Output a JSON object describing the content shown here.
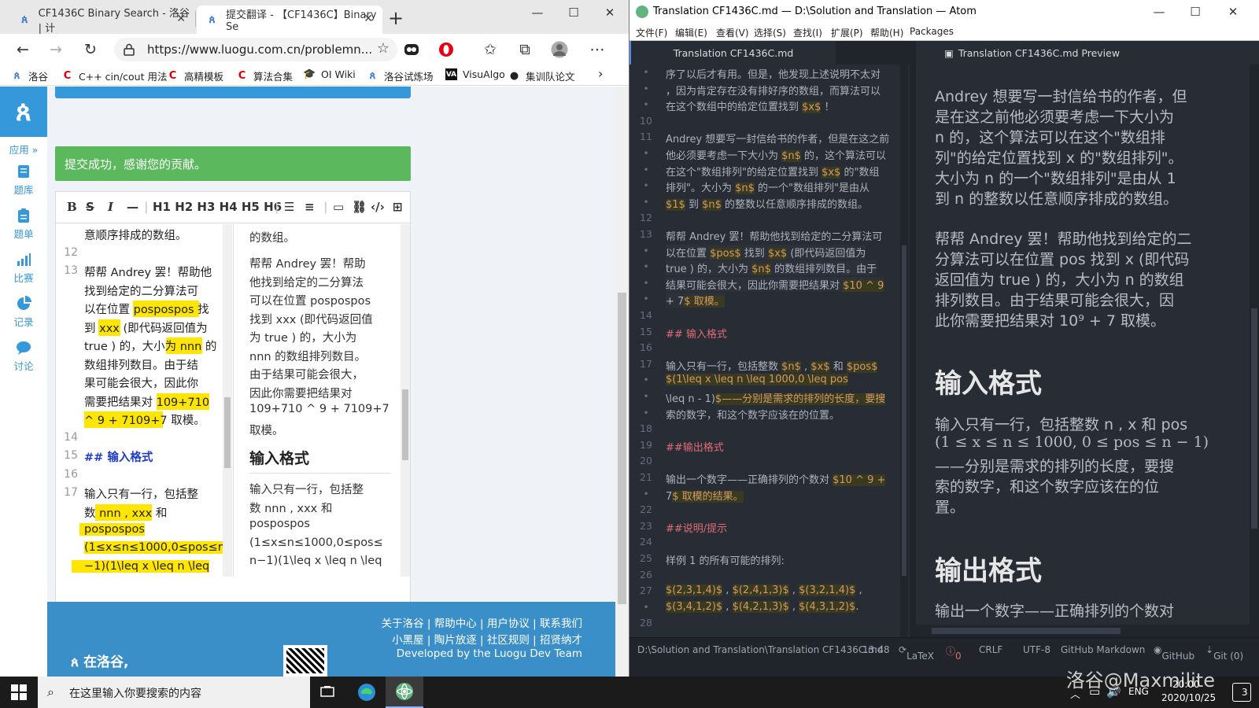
{
  "edge": {
    "tabs": [
      {
        "title": "CF1436C Binary Search - 洛谷 | 计"
      },
      {
        "title": "提交翻译 - 【CF1436C】Binary Se"
      }
    ],
    "url": "https://www.luogu.com.cn/problemn...",
    "bookmarks": [
      "洛谷",
      "C++ cin/cout 用法",
      "高精模板",
      "算法合集",
      "OI Wiki",
      "洛谷试炼场",
      "VisuAlgo",
      "集训队论文"
    ]
  },
  "luogu": {
    "sidebar": [
      {
        "label": "应用 »"
      },
      {
        "label": "题库"
      },
      {
        "label": "题单"
      },
      {
        "label": "比赛"
      },
      {
        "label": "记录"
      },
      {
        "label": "讨论"
      }
    ],
    "success": "提交成功，感谢您的贡献。",
    "toolbar_headings": "H1 H2 H3 H4 H5 H6",
    "source_lines": [
      {
        "n": "",
        "t": "意顺序排成的数组。"
      },
      {
        "n": "12",
        "t": ""
      },
      {
        "n": "13",
        "t": "帮帮 Andrey 罢！帮助他"
      },
      {
        "n": "",
        "t": "找到给定的二分算法可"
      },
      {
        "n": "",
        "t": "以在位置 pospospos 找"
      },
      {
        "n": "",
        "t": "到 xxx (即代码返回值为"
      },
      {
        "n": "",
        "t": "true ) 的，大小为 nnn 的"
      },
      {
        "n": "",
        "t": "数组排列数目。由于结"
      },
      {
        "n": "",
        "t": "果可能会很大，因此你"
      },
      {
        "n": "",
        "t": "需要把结果对 109+710"
      },
      {
        "n": "",
        "t": "^ 9 + 7109+7 取模。"
      },
      {
        "n": "14",
        "t": ""
      },
      {
        "n": "15",
        "t": "## 输入格式"
      },
      {
        "n": "16",
        "t": ""
      },
      {
        "n": "17",
        "t": "输入只有一行，包括整"
      },
      {
        "n": "",
        "t": "数 nnn , xxx 和"
      },
      {
        "n": "",
        "t": "pospospos"
      },
      {
        "n": "",
        "t": "(1≤x≤n≤1000,0≤pos≤n"
      },
      {
        "n": "",
        "t": "−1)(1\\leq x \\leq n \\leq"
      }
    ],
    "preview_lines": [
      "的数组。",
      "帮帮 Andrey 罢！帮助",
      "他找到给定的二分算法",
      "可以在位置 pospospos",
      "找到 xxx (即代码返回值",
      "为 true ) 的，大小为",
      "nnn 的数组排列数目。",
      "由于结果可能会很大，",
      "因此你需要把结果对",
      "109+710 ^ 9 + 7109+7",
      "取模。"
    ],
    "preview_heading": "输入格式",
    "preview_lines2": [
      "输入只有一行，包括整",
      "数 nnn , xxx 和",
      "pospospos",
      "(1≤x≤n≤1000,0≤pos≤",
      "n−1)(1\\leq x \\leq n \\leq"
    ],
    "footer": {
      "links1": "关于洛谷 | 帮助中心 | 用户协议 | 联系我们",
      "links2": "小黑屋 | 陶片放逐 | 社区规则 | 招贤纳才",
      "credit": "Developed by the Luogu Dev Team",
      "brand": "在洛谷,"
    }
  },
  "atom": {
    "title": "Translation CF1436C.md — D:\\Solution and Translation — Atom",
    "menu": [
      "文件(F)",
      "编辑(E)",
      "查看(V)",
      "选择(S)",
      "查找(I)",
      "扩展(P)",
      "帮助(H)",
      "Packages"
    ],
    "tab_editor": "Translation CF1436C.md",
    "tab_preview": "Translation CF1436C.md Preview",
    "gutter": [
      "•",
      "•",
      "•",
      "10",
      "11",
      "•",
      "•",
      "•",
      "•",
      "12",
      "13",
      "•",
      "•",
      "•",
      "•",
      "14",
      "15",
      "16",
      "17",
      "•",
      "•",
      "•",
      "18",
      "19",
      "20",
      "21",
      "•",
      "22",
      "23",
      "24",
      "25",
      "26",
      "27",
      "•",
      "28"
    ],
    "code_lines": [
      "序了以后才有用。但是，他发现上述说明不太对",
      "，因为肯定存在没有排好序的数组，而算法可以",
      "在这个数组中的给定位置找到 $x$ ！",
      "",
      "Andrey 想要写一封信给书的作者，但是在这之前",
      "他必须要考虑一下大小为 $n$ 的，这个算法可以",
      "在这个\"数组排列\"的给定位置找到 $x$ 的\"数组",
      "排列\"。大小为 $n$ 的一个\"数组排列\"是由从",
      "$1$ 到 $n$ 的整数以任意顺序排成的数组。",
      "",
      "帮帮 Andrey 罢！帮助他找到给定的二分算法可",
      "以在位置 $pos$ 找到 $x$ (即代码返回值为",
      "true ) 的，大小为 $n$ 的数组排列数目。由于",
      "结果可能会很大，因此你需要把结果对 $10 ^ 9",
      "+ 7$ 取模。",
      "",
      "## 输入格式",
      "",
      "输入只有一行，包括整数 $n$ , $x$ 和 $pos$",
      "$(1\\leq x \\leq n \\leq 1000,0 \\leq pos",
      "\\leq n - 1)$——分别是需求的排列的长度，要搜",
      "索的数字，和这个数字应该在的位置。",
      "",
      "##输出格式",
      "",
      "输出一个数字——正确排列的个数对 $10 ^ 9 +",
      "7$ 取模的结果。",
      "",
      "##说明/提示",
      "",
      "样例 1 的所有可能的排列:",
      "",
      "$(2,3,1,4)$ , $(2,4,1,3)$ , $(3,2,1,4)$ ,",
      "$(3,4,1,2)$ , $(4,2,1,3)$ , $(4,3,1,2)$.",
      ""
    ],
    "preview": {
      "p1": [
        "Andrey 想要写一封信给书的作者，但",
        "是在这之前他必须要考虑一下大小为",
        "n 的，这个算法可以在这个\"数组排",
        "列\"的给定位置找到 x 的\"数组排列\"。",
        "大小为 n 的一个\"数组排列\"是由从 1",
        "到 n 的整数以任意顺序排成的数组。"
      ],
      "p2": [
        "帮帮 Andrey 罢！帮助他找到给定的二",
        "分算法可以在位置 pos 找到 x (即代码",
        "返回值为 true ) 的，大小为 n 的数组",
        "排列数目。由于结果可能会很大，因",
        "此你需要把结果对 10⁹ + 7 取模。"
      ],
      "h_input": "输入格式",
      "p3": [
        "输入只有一行，包括整数 n , x 和 pos",
        "(1 ≤ x ≤ n ≤ 1000, 0 ≤ pos ≤ n − 1)",
        "——分别是需求的排列的长度，要搜",
        "索的数字，和这个数字应该在的位",
        "置。"
      ],
      "h_output": "输出格式",
      "p4": [
        "输出一个数字——正确排列的个数对"
      ]
    },
    "status": {
      "path": "D:\\Solution and Translation\\Translation CF1436C.md",
      "cursor": "13:48",
      "latex": "LaTeX",
      "errors": "0",
      "eol": "CRLF",
      "encoding": "UTF-8",
      "grammar": "GitHub Markdown",
      "github": "GitHub",
      "git": "Git (0)"
    }
  },
  "taskbar": {
    "search_placeholder": "在这里输入你要搜索的内容",
    "ime": "ENG",
    "time": "20:00",
    "date": "2020/10/25",
    "notifications": "3",
    "watermark": "洛谷@Maxmilite"
  }
}
